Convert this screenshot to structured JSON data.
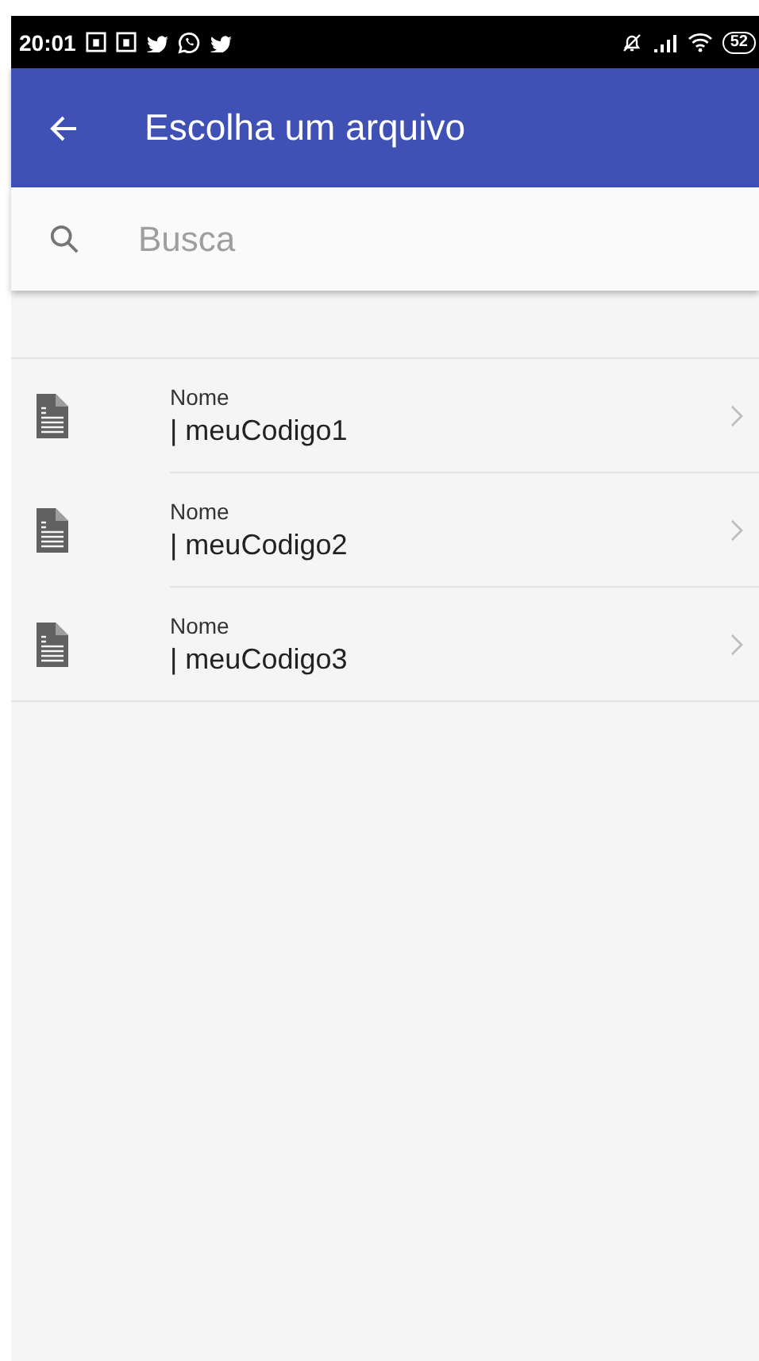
{
  "status_bar": {
    "time": "20:01",
    "battery": "52"
  },
  "app_bar": {
    "title": "Escolha um arquivo"
  },
  "search": {
    "placeholder": "Busca"
  },
  "files": [
    {
      "label": "Nome",
      "name": "| meuCodigo1"
    },
    {
      "label": "Nome",
      "name": "| meuCodigo2"
    },
    {
      "label": "Nome",
      "name": "| meuCodigo3"
    }
  ]
}
